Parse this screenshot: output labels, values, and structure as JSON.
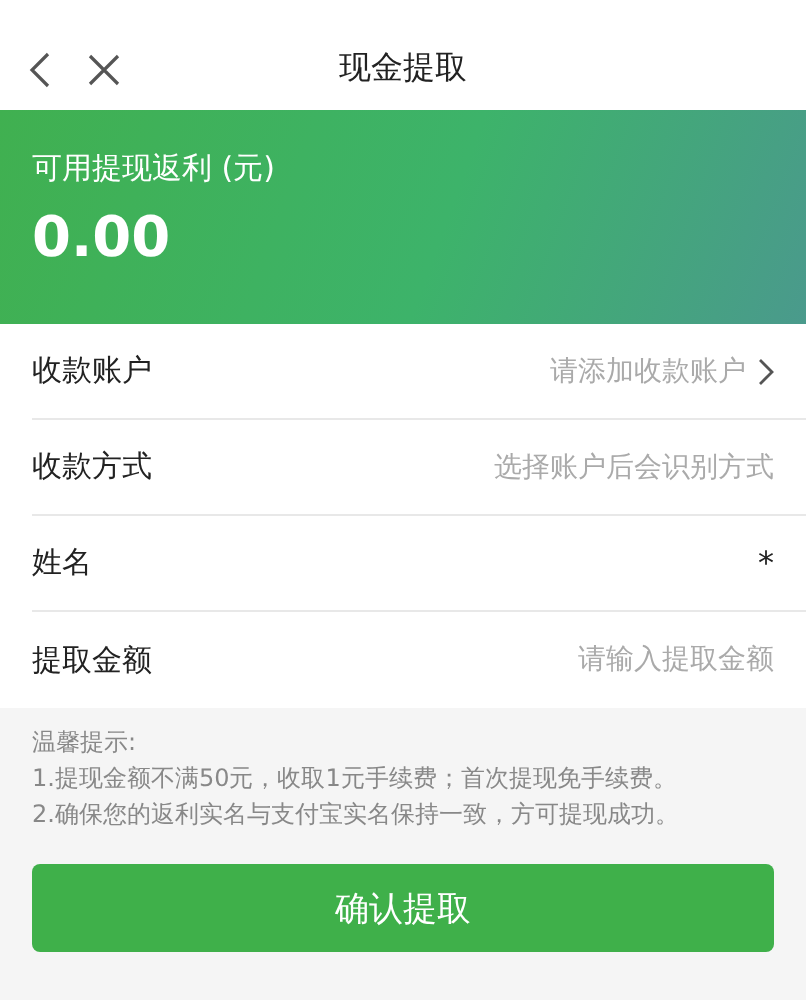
{
  "nav": {
    "title": "现金提取"
  },
  "balance": {
    "label": "可用提现返利 (元)",
    "amount": "0.00"
  },
  "rows": [
    {
      "kind": "link",
      "label": "收款账户",
      "hint": "请添加收款账户"
    },
    {
      "kind": "text",
      "label": "收款方式",
      "hint": "选择账户后会识别方式"
    },
    {
      "kind": "input",
      "label": "姓名",
      "mark": "*"
    },
    {
      "kind": "input",
      "label": "提取金额",
      "placeholder": "请输入提取金额"
    }
  ],
  "tips": [
    "温馨提示:",
    "1.提现金额不满50元，收取1元手续费；首次提现免手续费。",
    "2.确保您的返利实名与支付宝实名保持一致，方可提现成功。"
  ],
  "button": "确认提取"
}
